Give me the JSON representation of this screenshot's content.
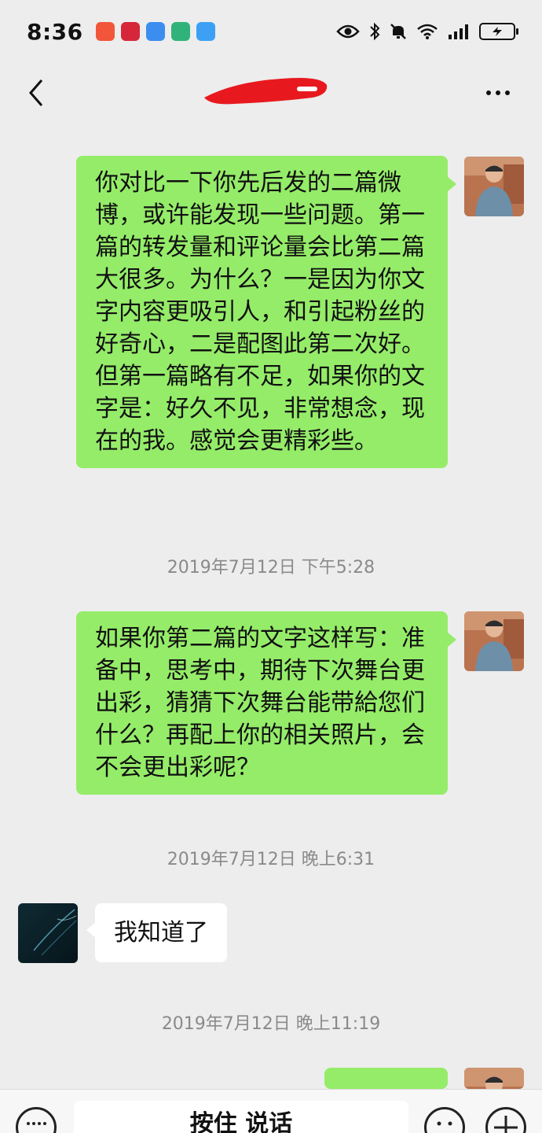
{
  "status_bar": {
    "time": "8:36",
    "app_icon_colors": [
      "#f2553a",
      "#d6263a",
      "#3b8df0",
      "#2fb37a",
      "#3da0f5"
    ]
  },
  "nav": {
    "back_icon": "chevron-left-icon",
    "more_icon": "more-dots-icon",
    "title_redaction_color": "#e8191e"
  },
  "messages": [
    {
      "direction": "out",
      "text": "你对比一下你先后发的二篇微博，或许能发现一些问题。第一篇的转发量和评论量会比第二篇大很多。为什么？一是因为你文字内容更吸引人，和引起粉丝的好奇心，二是配图此第二次好。但第一篇略有不足，如果你的文字是：好久不见，非常想念，现在的我。感觉会更精彩些。"
    },
    {
      "direction": "out",
      "text": "如果你第二篇的文字这样写：准备中，思考中，期待下次舞台更出彩，猜猜下次舞台能带給您们什么？再配上你的相关照片，会不会更出彩呢？"
    },
    {
      "direction": "in",
      "text": "我知道了"
    }
  ],
  "timestamps": [
    "2019年7月12日 下午5:28",
    "2019年7月12日 晚上6:31",
    "2019年7月12日 晚上11:19"
  ],
  "input_bar": {
    "hold_to_talk_label": "按住 说话",
    "left_icon": "keyboard-icon",
    "emoji_icon": "emoji-icon",
    "plus_icon": "plus-icon"
  },
  "colors": {
    "background": "#ededed",
    "outgoing_bubble": "#95ec69",
    "incoming_bubble": "#ffffff",
    "timestamp_text": "#8a8a8a"
  }
}
